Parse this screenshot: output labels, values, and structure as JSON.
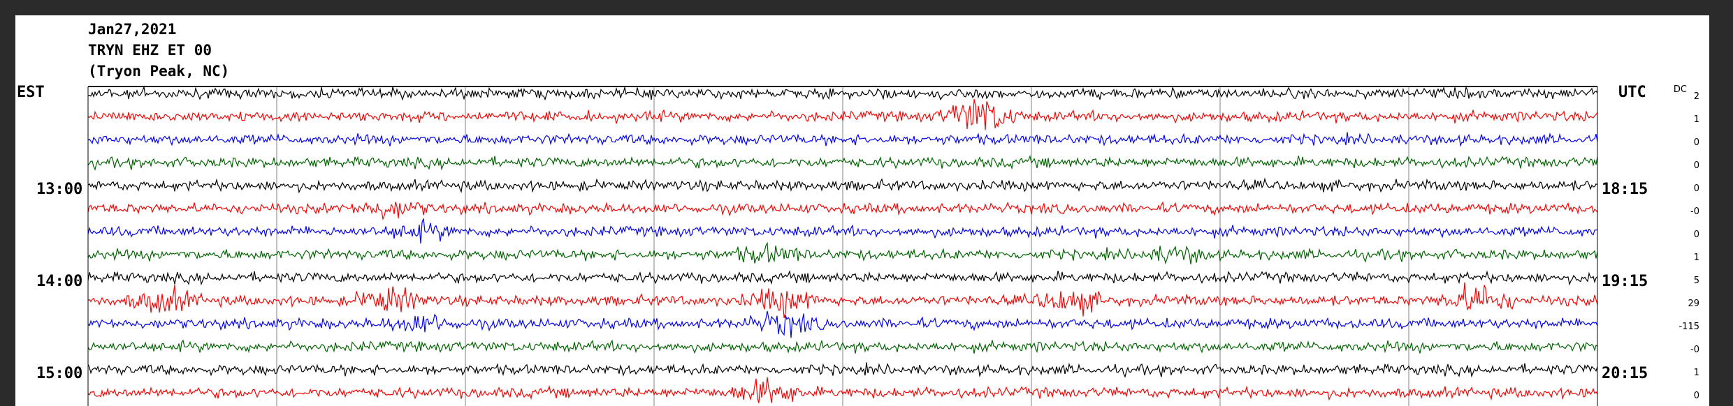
{
  "header": {
    "date": "Jan27,2021",
    "station": "TRYN EHZ ET 00",
    "location": "(Tryon Peak, NC)"
  },
  "chart_data": {
    "type": "line",
    "title": "",
    "left_axis_label": "EST",
    "right_axis_label": "UTC",
    "left_time_labels": [
      "13:00",
      "14:00",
      "15:00"
    ],
    "right_time_labels": [
      "18:15",
      "19:15",
      "20:15"
    ],
    "dc_label": "DC",
    "dc_offsets": [
      "2",
      "1",
      "0",
      "0",
      "0",
      "-0",
      "0",
      "1",
      "5",
      "29",
      "-115",
      "-0",
      "1",
      "0"
    ],
    "trace_colors": [
      "#000000",
      "#ff0000",
      "#0000ff",
      "#006400"
    ],
    "traces_visible": 14,
    "minutes_per_trace": 15,
    "vertical_gridlines": 5,
    "events": [
      {
        "trace": 1,
        "at": 0.59,
        "strength": 3.5
      },
      {
        "trace": 5,
        "at": 0.2,
        "strength": 1.6
      },
      {
        "trace": 6,
        "at": 0.22,
        "strength": 1.2
      },
      {
        "trace": 7,
        "at": 0.45,
        "strength": 1.3
      },
      {
        "trace": 7,
        "at": 0.72,
        "strength": 1.2
      },
      {
        "trace": 9,
        "at": 0.05,
        "strength": 2.0
      },
      {
        "trace": 9,
        "at": 0.2,
        "strength": 2.2
      },
      {
        "trace": 9,
        "at": 0.46,
        "strength": 2.2
      },
      {
        "trace": 9,
        "at": 0.65,
        "strength": 2.0
      },
      {
        "trace": 9,
        "at": 0.92,
        "strength": 2.8
      },
      {
        "trace": 10,
        "at": 0.22,
        "strength": 1.5
      },
      {
        "trace": 10,
        "at": 0.46,
        "strength": 1.8
      },
      {
        "trace": 13,
        "at": 0.45,
        "strength": 2.2
      }
    ]
  }
}
